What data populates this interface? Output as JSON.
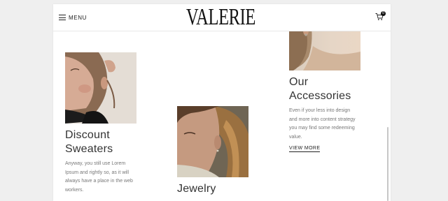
{
  "header": {
    "menu_label": "MENU",
    "logo_text": "VALERIE",
    "cart_count": "0"
  },
  "cards": [
    {
      "image_icon": "portrait-photo",
      "title_line1": "Discount",
      "title_line2": "Sweaters",
      "description": [
        "Anyway, you still use Lorem",
        "Ipsum and rightly so, as it will",
        "always have a place in the web",
        "workers."
      ]
    },
    {
      "image_icon": "portrait-photo",
      "title_line1": "Jewelry",
      "title_line2": ""
    },
    {
      "image_icon": "portrait-photo",
      "title_line1": "Our",
      "title_line2": "Accessories",
      "description": [
        "Even if your less into design",
        "and more into content strategy",
        "you may find some redeeming",
        "value."
      ],
      "link_label": "VIEW MORE"
    }
  ],
  "colors": {
    "background": "#efefef",
    "panel": "#ffffff",
    "text_dark": "#333333",
    "text_muted": "#777777"
  }
}
